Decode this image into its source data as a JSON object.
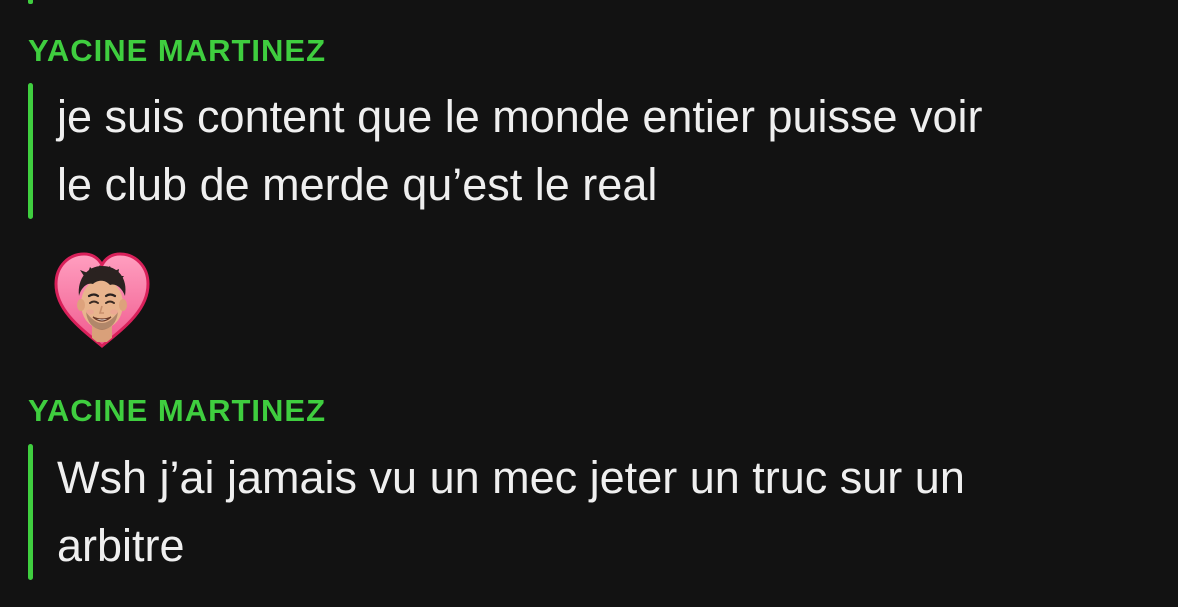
{
  "theme": {
    "background": "#121212",
    "accent": "#3fce3f",
    "text": "#efefef"
  },
  "messages": [
    {
      "sender": "YACINE MARTINEZ",
      "text": "je suis content que le monde entier puisse voir\nle club de merde qu’est le real",
      "reaction": "heart-bitmoji-icon"
    },
    {
      "sender": "YACINE MARTINEZ",
      "text": "Wsh j’ai jamais vu un mec jeter un truc sur un\narbitre"
    }
  ]
}
